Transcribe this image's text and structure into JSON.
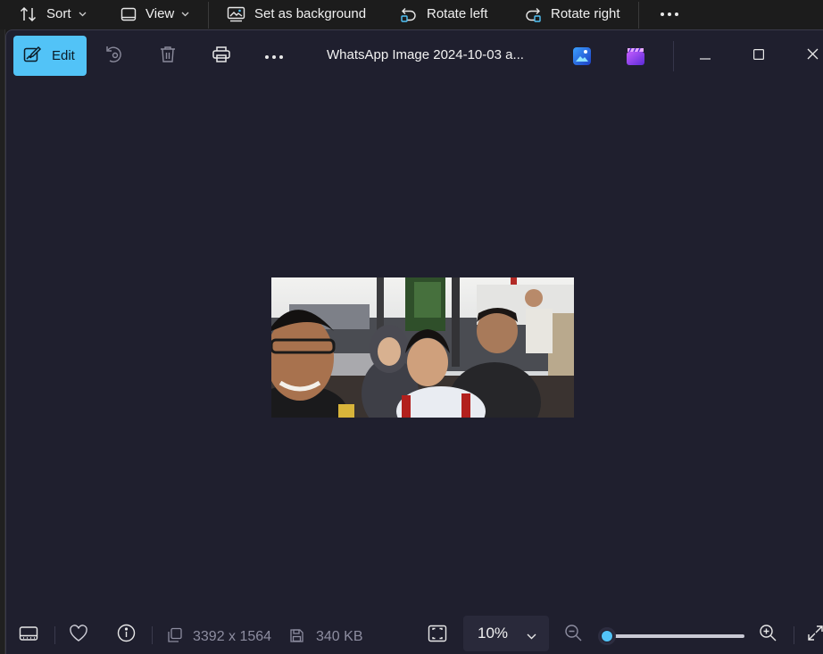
{
  "explorer_toolbar": {
    "sort_label": "Sort",
    "view_label": "View",
    "set_background_label": "Set as background",
    "rotate_left_label": "Rotate left",
    "rotate_right_label": "Rotate right"
  },
  "photos": {
    "edit_label": "Edit",
    "title": "WhatsApp Image 2024-10-03 a...",
    "accent_color": "#52c3f7",
    "background_color": "#1f1f2e"
  },
  "status_bar": {
    "dimensions": "3392 x 1564",
    "file_size": "340 KB",
    "zoom_value": "10%",
    "zoom_level": 0.1
  },
  "icons": [
    "sort-icon",
    "view-icon",
    "set-background-icon",
    "rotate-left-icon",
    "rotate-right-icon",
    "more-icon",
    "edit-icon",
    "rotate-icon",
    "delete-icon",
    "print-icon",
    "designer-icon",
    "clipchamp-icon",
    "minimize-icon",
    "maximize-icon",
    "close-icon",
    "filmstrip-icon",
    "heart-icon",
    "info-icon",
    "dimensions-icon",
    "file-size-icon",
    "fit-screen-icon",
    "zoom-out-icon",
    "zoom-in-icon",
    "fullscreen-icon"
  ]
}
